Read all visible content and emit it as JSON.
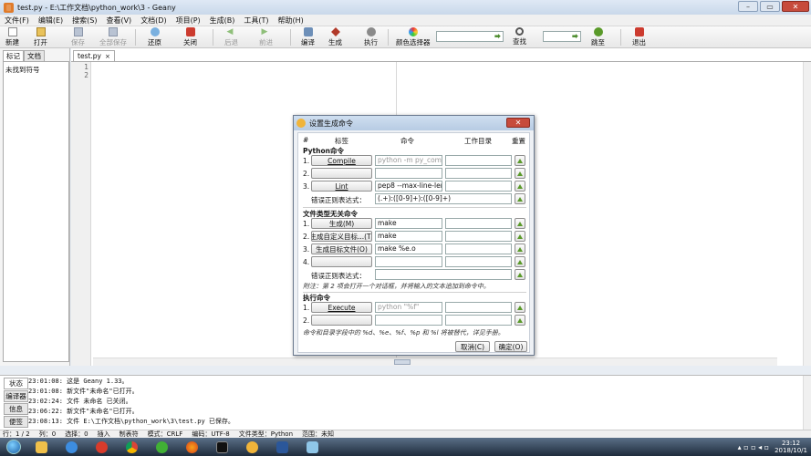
{
  "window": {
    "title": "test.py - E:\\工作文档\\python_work\\3 - Geany"
  },
  "menu": [
    "文件(F)",
    "编辑(E)",
    "搜索(S)",
    "查看(V)",
    "文档(D)",
    "项目(P)",
    "生成(B)",
    "工具(T)",
    "帮助(H)"
  ],
  "toolbar": {
    "new": "新建",
    "open": "打开",
    "save": "保存",
    "save_all": "全部保存",
    "revert": "还原",
    "close": "关闭",
    "back": "后退",
    "forward": "前进",
    "compile": "编译",
    "build": "生成",
    "execute": "执行",
    "color_chooser": "颜色选择器",
    "find": "查找",
    "goto": "跳至",
    "quit": "退出"
  },
  "sidebar": {
    "tabs": [
      "标记",
      "文档"
    ],
    "active_tab": "标记",
    "content": "未找到符号"
  },
  "editor": {
    "tab_label": "test.py",
    "tab_close": "×",
    "line_numbers": [
      "1",
      "2"
    ]
  },
  "dialog": {
    "title": "设置生成命令",
    "headers": {
      "num": "#",
      "label": "标签",
      "command": "命令",
      "workdir": "工作目录",
      "reset": "重置"
    },
    "python_section": "Python命令",
    "python_rows": [
      {
        "num": "1.",
        "label": "Compile",
        "command": "python -m py_compi",
        "placeholder": true
      },
      {
        "num": "2.",
        "label": "",
        "command": "",
        "placeholder": false
      },
      {
        "num": "3.",
        "label": "Lint",
        "command": "pep8 --max-line-leng",
        "placeholder": false
      }
    ],
    "python_regex_label": "错误正则表达式：",
    "python_regex": "(.+):([0-9]+):([0-9]+)",
    "independent_section": "文件类型无关命令",
    "independent_rows": [
      {
        "num": "1.",
        "label": "生成(M)",
        "command": "make"
      },
      {
        "num": "2.",
        "label": "生成自定义目标...(T)",
        "command": "make"
      },
      {
        "num": "3.",
        "label": "生成目标文件(O)",
        "command": "make %e.o"
      },
      {
        "num": "4.",
        "label": "",
        "command": ""
      }
    ],
    "independent_regex_label": "错误正则表达式：",
    "independent_regex": "",
    "note": "附注：第 2 项会打开一个对话框，并将输入的文本追加到命令中。",
    "execute_section": "执行命令",
    "execute_rows": [
      {
        "num": "1.",
        "label": "Execute",
        "command": "python \"%f\"",
        "placeholder": true
      },
      {
        "num": "2.",
        "label": "",
        "command": "",
        "placeholder": false
      }
    ],
    "footer_note": "命令和目录字段中的 %d、%e、%f、%p 和 %l 将被替代，详见手册。",
    "cancel": "取消(C)",
    "ok": "确定(O)"
  },
  "messages": {
    "tabs": [
      "状态",
      "编译器",
      "信息",
      "便签"
    ],
    "lines": [
      "23:01:08: 这是 Geany 1.33。",
      "23:01:08: 新文件\"未命名\"已打开。",
      "23:02:24: 文件 未命名 已关闭。",
      "23:06:22: 新文件\"未命名\"已打开。",
      "23:08:13: 文件 E:\\工作文档\\python_work\\3\\test.py 已保存。"
    ]
  },
  "statusbar": [
    "行：1 / 2",
    "列：0",
    "选择：0",
    "插入",
    "制表符",
    "模式：CRLF",
    "编码：UTF-8",
    "文件类型：Python",
    "范围：未知"
  ],
  "tray": {
    "time": "23:12",
    "date": "2018/10/1"
  }
}
